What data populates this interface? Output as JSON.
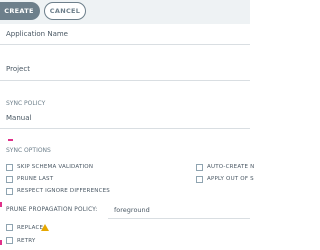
{
  "toolbar": {
    "create_label": "CREATE",
    "cancel_label": "CANCEL"
  },
  "fields": {
    "application_name_placeholder": "Application Name",
    "project_placeholder": "Project"
  },
  "sync_policy": {
    "label": "SYNC POLICY",
    "value": "Manual"
  },
  "sync_options": {
    "label": "SYNC OPTIONS",
    "left": [
      "SKIP SCHEMA VALIDATION",
      "PRUNE LAST",
      "RESPECT IGNORE DIFFERENCES"
    ],
    "right": [
      "AUTO-CREATE N",
      "APPLY OUT OF S"
    ]
  },
  "prune_propagation": {
    "label": "PRUNE PROPAGATION POLICY:",
    "value": "foreground"
  },
  "extra_options": {
    "replace": "REPLACE",
    "retry": "RETRY"
  },
  "colors": {
    "accent": "#6d7f8b",
    "marker": "#e0308a",
    "warning": "#e6a700"
  }
}
